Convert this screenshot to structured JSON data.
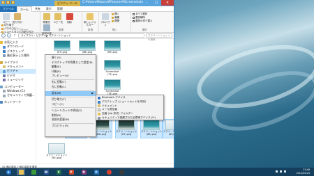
{
  "window": {
    "title": "C:¥Users¥Kaoru¥Pictures¥Screenshots",
    "context_tab": "ピクチャ ツール",
    "tabs": [
      "ファイル",
      "ホーム",
      "共有",
      "表示",
      "管理"
    ],
    "ribbon": {
      "clipboard": {
        "label": "クリップボード",
        "copy": "コピー",
        "paste": "貼り付け",
        "cut": "切り取り",
        "copy_path": "パスのコピー",
        "paste_shortcut": "ショートカットの貼り付け"
      },
      "organize": {
        "label": "整理",
        "move_to": "移動先",
        "copy_to": "コピー先",
        "delete": "削除",
        "rename": "名前の変更"
      },
      "new": {
        "label": "新規",
        "new_folder": "新しいフォルダー"
      },
      "open": {
        "label": "開く",
        "properties": "プロパティ",
        "open": "開く",
        "edit": "編集",
        "history": "履歴"
      },
      "select": {
        "label": "選択",
        "select_all": "すべて選択",
        "select_none": "選択解除",
        "invert": "選択の切り替え"
      }
    },
    "address": "ライブラリ › ピクチャ › スクリーンショット",
    "search_placeholder": "スクリーンショットの検索",
    "status": "52 個の項目   7 個の項目を選択"
  },
  "nav": {
    "favorites": "お気に入り",
    "downloads": "ダウンロード",
    "desktop": "デスクトップ",
    "recent": "最近表示した場所",
    "libraries": "ライブラリ",
    "documents": "ドキュメント",
    "pictures": "ピクチャ",
    "video": "ビデオ",
    "music": "ミュージック",
    "computer": "コンピューター",
    "windows_c": "Windows (C:)",
    "kingston": "セキュリティで保護...",
    "network": "ネットワーク"
  },
  "thumbs": [
    {
      "cap": "(67).png",
      "style": "teal"
    },
    {
      "cap": "(68).png",
      "style": "teal"
    },
    {
      "cap": "(69).png",
      "style": "teal"
    },
    {
      "cap": "Screenshot",
      "cap2": "(71).png",
      "style": "teal"
    },
    {
      "cap": "Screenshot",
      "cap2": "(72).png",
      "style": "teal"
    },
    {
      "cap": "Screenshot",
      "cap2": "(73).png",
      "style": "teal"
    },
    {
      "cap": "Screenshot",
      "cap2": "(74).png",
      "style": "teal"
    },
    {
      "cap": "Screenshot",
      "cap2": "(75).png",
      "style": "teal"
    },
    {
      "cap": "Screenshot",
      "cap2": "(76).png",
      "style": "teal"
    },
    {
      "cap": "(77).png",
      "style": "teal"
    },
    {
      "cap": "(78).png",
      "style": "teal"
    },
    {
      "cap": "(79).png",
      "style": "teal"
    },
    {
      "cap": "Screenshot",
      "cap2": "(82).png",
      "style": "teal"
    },
    {
      "cap": "スクリーンショット",
      "cap2": "(85).png",
      "style": "teal"
    },
    {
      "cap": "スクリーンショット",
      "cap2": "(86).png",
      "style": "dark"
    },
    {
      "cap": "スクリーンショット",
      "cap2": "(87).png",
      "style": "dark"
    },
    {
      "cap": "スクリーンショット",
      "cap2": "(88).png",
      "style": "teal"
    },
    {
      "cap": "スクリーンショット",
      "cap2": "(89).png",
      "style": "light"
    },
    {
      "cap": "スクリーンショット",
      "cap2": "(90).png",
      "style": "light"
    }
  ],
  "context_menu": [
    "開く(O)",
    "デスクトップの背景として設定(B)",
    "編集(E)",
    "印刷(P)",
    "プレビュー(V)",
    "右に回転(T)",
    "左に回転(L)",
    "送る(N)",
    "切り取り(T)",
    "コピー(C)",
    "ショートカットの作成(S)",
    "削除(D)",
    "名前の変更(M)",
    "プロパティ(R)"
  ],
  "send_to": [
    "Bluetooth デバイス",
    "デスクトップ (ショートカットを作成)",
    "ドキュメント",
    "メール受信者",
    "圧縮 (zip 形式) フォルダー",
    "セキュリティで保護された記憶域デバイス (E:)"
  ],
  "taskbar": {
    "apps": [
      "IE",
      "エクスプローラー",
      "ストア",
      "W",
      "X",
      "P",
      "N",
      "O",
      "C",
      "M"
    ],
    "time": "23:48",
    "date": "2013/02/24"
  }
}
